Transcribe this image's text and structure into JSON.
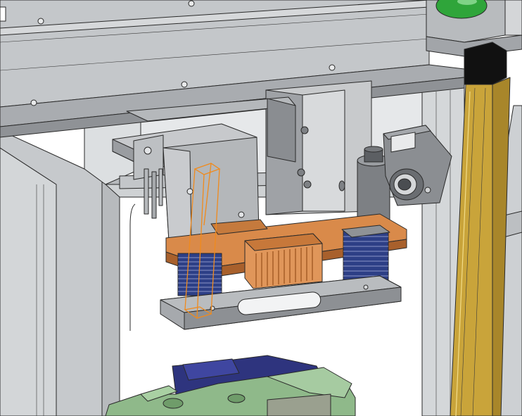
{
  "colors": {
    "background": "#ffffff",
    "frame_grey": "#c9cbcd",
    "frame_dark": "#8f9296",
    "interior_wall": "#d9dcde",
    "block_grey": "#b9bbbd",
    "copper": "#d98a4a",
    "copper_dark": "#a8602c",
    "spring_blue": "#2d3f86",
    "light_curtain": "#c9a43a",
    "selection_orange": "#f08a1c",
    "green_part": "#8fb98a",
    "navy_part": "#2e347e",
    "indicator_green": "#2fa53a"
  },
  "components": [
    {
      "id": "top-beam",
      "kind": "extrusion"
    },
    {
      "id": "rear-frame",
      "kind": "enclosure"
    },
    {
      "id": "vertical-slide-block",
      "kind": "block"
    },
    {
      "id": "clamp-arm",
      "kind": "bracket"
    },
    {
      "id": "selected-guide-bar",
      "kind": "highlighted-edge"
    },
    {
      "id": "copper-mount-plate",
      "kind": "plate"
    },
    {
      "id": "compression-spring-left",
      "kind": "spring"
    },
    {
      "id": "compression-spring-right",
      "kind": "spring"
    },
    {
      "id": "copper-heat-sink",
      "kind": "finned-block"
    },
    {
      "id": "base-plate",
      "kind": "plate"
    },
    {
      "id": "vision-camera",
      "kind": "camera"
    },
    {
      "id": "cylinder-actuator",
      "kind": "cylinder"
    },
    {
      "id": "light-curtain",
      "kind": "safety-sensor"
    },
    {
      "id": "indicator-lamp",
      "kind": "lamp"
    },
    {
      "id": "workpiece-fixture",
      "kind": "fixture"
    }
  ]
}
